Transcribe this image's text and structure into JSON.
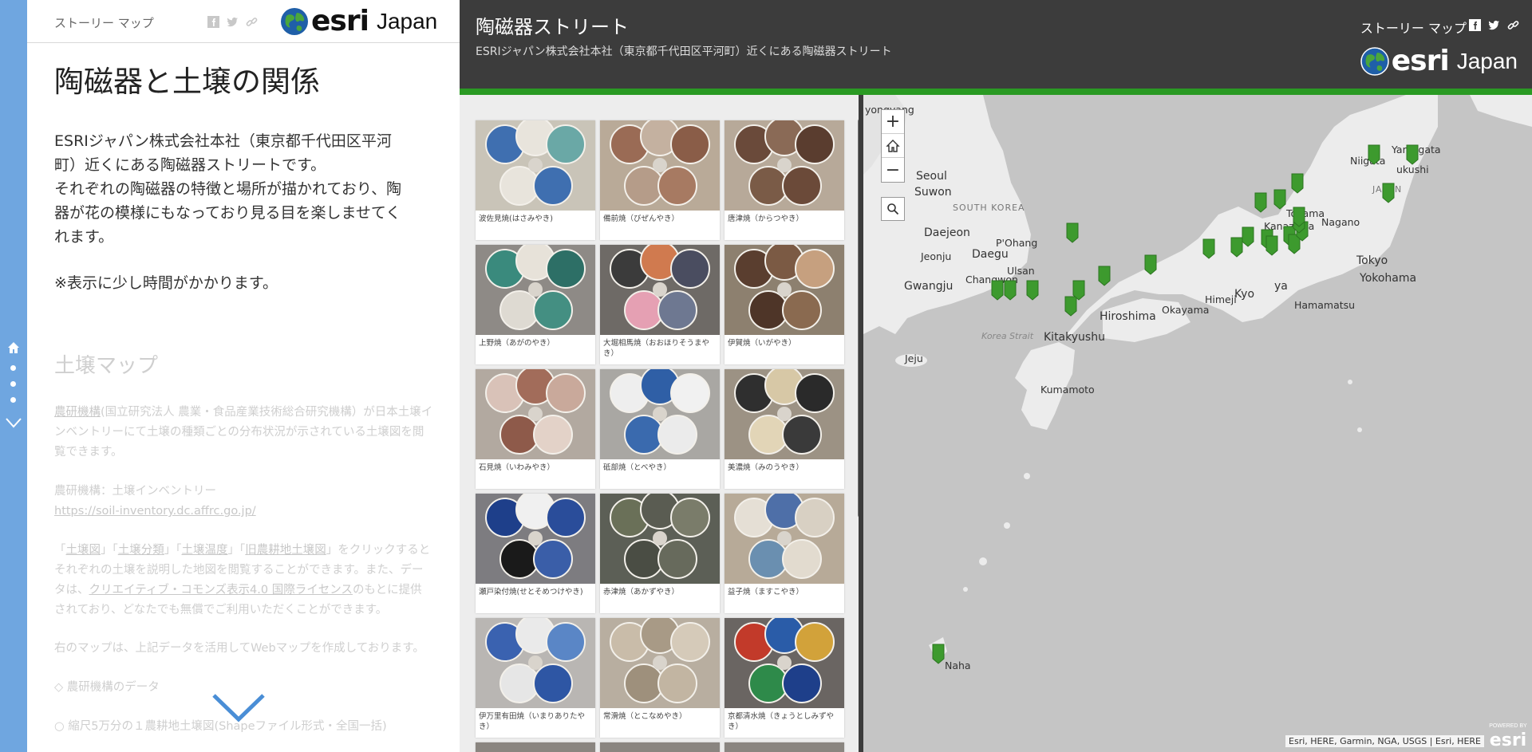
{
  "sidebar": {
    "header_label": "ストーリー マップ",
    "logo_text": "esri",
    "logo_region": "Japan",
    "title": "陶磁器と土壌の関係",
    "description_lines": [
      "ESRIジャパン株式会社本社（東京都千代田区平河",
      "町）近くにある陶磁器ストリートです。",
      "それぞれの陶磁器の特徴と場所が描かれており、陶",
      "器が花の模様にもなっており見る目を楽しませてく",
      "れます。"
    ],
    "note": "※表示に少し時間がかかります。",
    "soil_map_title": "土壌マップ",
    "soil_p1_link": "農研機構",
    "soil_p1": "(国立研究法人 農業・食品産業技術総合研究機構）が日本土壌インベントリーにて土壌の種類ごとの分布状況が示されている土壌図を閲覧できます。",
    "soil_p2_label": "農研機構：土壌インベントリー",
    "soil_p2_link": "https://soil-inventory.dc.affrc.go.jp/",
    "soil_p3_links": [
      "土壌図",
      "土壌分類",
      "土壌温度",
      "旧農耕地土壌図"
    ],
    "soil_p3_text": "をクリックするとそれぞれの土壌を説明した地図を閲覧することができます。また、データは、",
    "soil_p3_license": "クリエイティブ・コモンズ表示4.0 国際ライセンス",
    "soil_p3_tail": "のもとに提供されており、どなたでも無償でご利用いただくことができます。",
    "soil_p4": "右のマップは、上記データを活用してWebマップを作成しております。",
    "soil_p5": "◇ 農研機構のデータ",
    "soil_p6": "○ 縮尺5万分の１農耕地土壌図(Shapeファイル形式・全国一括)"
  },
  "header": {
    "title": "陶磁器ストリート",
    "subtitle": "ESRIジャパン株式会社本社（東京都千代田区平河町）近くにある陶磁器ストリート",
    "story_map_label": "ストーリー マップ",
    "logo_text": "esri",
    "logo_region": "Japan"
  },
  "gallery": {
    "tiles": [
      {
        "caption": "波佐見焼(はさみやき)",
        "theme": "hasami"
      },
      {
        "caption": "備前焼（びぜんやき）",
        "theme": "bizen"
      },
      {
        "caption": "唐津焼（からつやき）",
        "theme": "karatsu"
      },
      {
        "caption": "上野焼（あがのやき）",
        "theme": "agano"
      },
      {
        "caption": "大堀相馬焼（おおほりそうまやき）",
        "theme": "soma"
      },
      {
        "caption": "伊賀焼（いがやき）",
        "theme": "iga"
      },
      {
        "caption": "石見焼（いわみやき）",
        "theme": "iwami"
      },
      {
        "caption": "砥部焼（とべやき）",
        "theme": "tobe"
      },
      {
        "caption": "美濃焼（みのうやき）",
        "theme": "mino"
      },
      {
        "caption": "瀬戸染付焼(せとそめつけやき)",
        "theme": "seto"
      },
      {
        "caption": "赤津焼（あかずやき）",
        "theme": "akazu"
      },
      {
        "caption": "益子焼（ますこやき）",
        "theme": "mashiko"
      },
      {
        "caption": "伊万里有田焼（いまりありたやき）",
        "theme": "imari"
      },
      {
        "caption": "常滑焼（とこなめやき）",
        "theme": "tokoname"
      },
      {
        "caption": "京都清水焼（きょうとしみずやき）",
        "theme": "kiyomizu"
      }
    ]
  },
  "map": {
    "labels": {
      "pyongyang": "yongyang",
      "seoul": "Seoul",
      "suwon": "Suwon",
      "south_korea": "SOUTH KOREA",
      "daejeon": "Daejeon",
      "pohang": "P'Ohang",
      "jeonju": "Jeonju",
      "daegu": "Daegu",
      "ulsan": "Ulsan",
      "gwangju": "Gwangju",
      "changwon": "Changwon",
      "korea_strait": "Korea Strait",
      "jeju": "Jeju",
      "kitakyushu": "Kitakyushu",
      "hiroshima": "Hiroshima",
      "okayama": "Okayama",
      "himeji": "Himeji",
      "kyoto": "Kyo",
      "nagoya": "ya",
      "hamamatsu": "Hamamatsu",
      "kumamoto": "Kumamoto",
      "toyama": "Toyama",
      "kanazawa": "Kanazawa",
      "nagano": "Nagano",
      "niigata": "Niigata",
      "yamagata": "Yamagata",
      "fukushima": "ukushi",
      "japan": "JAPAN",
      "tokyo": "Tokyo",
      "yokohama": "Yokohama",
      "naha": "Naha"
    },
    "attribution": "Esri, HERE, Garmin, NGA, USGS | Esri, HERE",
    "powered_by": "POWERED BY",
    "powered_logo": "esri",
    "pin_color": "#3d9a2e"
  }
}
